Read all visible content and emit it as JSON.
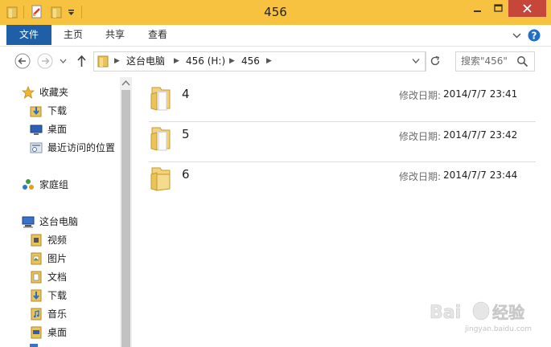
{
  "window": {
    "title": "456"
  },
  "ribbon": {
    "tabs": [
      "文件",
      "主页",
      "共享",
      "查看"
    ]
  },
  "address": {
    "breadcrumbs": [
      "这台电脑",
      "456 (H:)",
      "456"
    ]
  },
  "search": {
    "placeholder": "搜索\"456\""
  },
  "nav": {
    "favorites": {
      "label": "收藏夹",
      "items": [
        "下载",
        "桌面",
        "最近访问的位置"
      ]
    },
    "homegroup": {
      "label": "家庭组"
    },
    "thispc": {
      "label": "这台电脑",
      "items": [
        "视频",
        "图片",
        "文档",
        "下载",
        "音乐",
        "桌面"
      ]
    }
  },
  "files": [
    {
      "name": "4",
      "meta_label": "修改日期:",
      "date": "2014/7/7 23:41"
    },
    {
      "name": "5",
      "meta_label": "修改日期:",
      "date": "2014/7/7 23:42"
    },
    {
      "name": "6",
      "meta_label": "修改日期:",
      "date": "2014/7/7 23:44"
    }
  ],
  "watermark": {
    "text": "Bai 经验",
    "url": "jingyan.baidu.com"
  },
  "colors": {
    "titlebar": "#f7c23f",
    "file_tab": "#1f5fa8",
    "close": "#c7463a",
    "folder": "#e8c45a"
  }
}
